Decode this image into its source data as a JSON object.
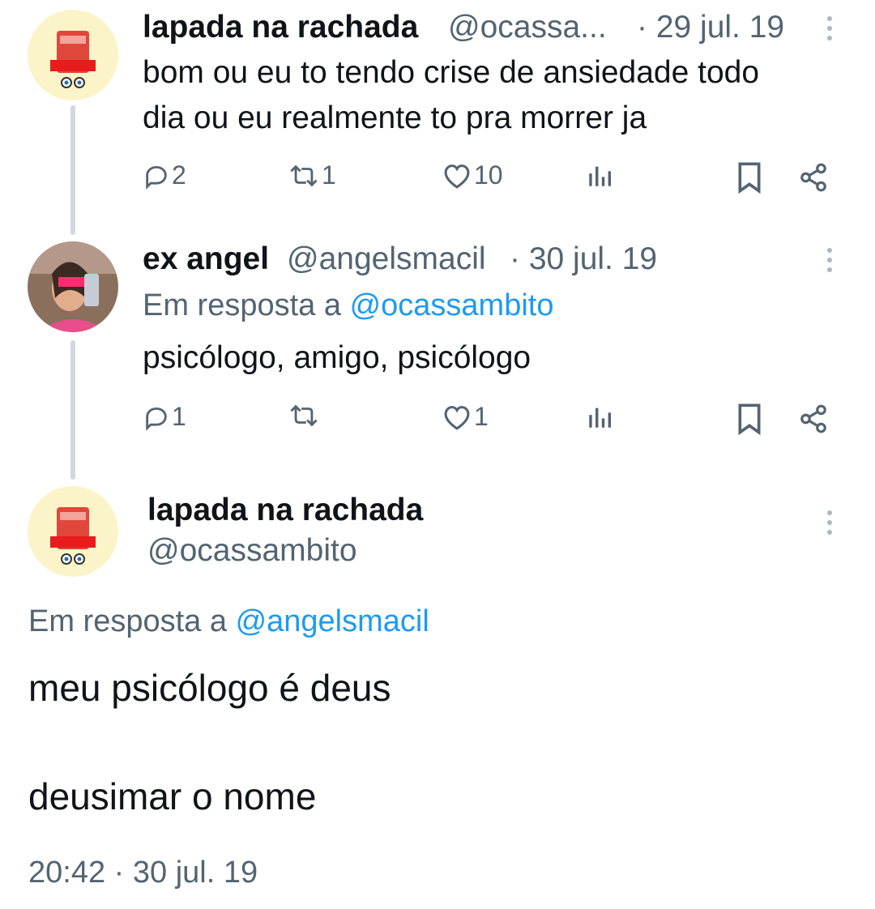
{
  "tweets": [
    {
      "name": "lapada na rachada",
      "handle": "@ocassa...",
      "date": "· 29 jul. 19",
      "text_line1": "bom ou eu to tendo crise de ansiedade todo",
      "text_line2": "dia ou eu realmente to pra morrer ja",
      "replies": "2",
      "retweets": "1",
      "likes": "10"
    },
    {
      "name": "ex angel",
      "handle": "@angelsmacil",
      "date": "· 30 jul. 19",
      "reply_prefix": "Em resposta a ",
      "reply_mention": "@ocassambito",
      "text": "psicólogo, amigo, psicólogo",
      "replies": "1",
      "retweets": "",
      "likes": "1"
    }
  ],
  "main_tweet": {
    "name": "lapada na rachada",
    "handle": "@ocassambito",
    "reply_prefix": "Em resposta a ",
    "reply_mention": "@angelsmacil",
    "text_line1": "meu psicólogo é deus",
    "text_line2": "deusimar o nome",
    "timestamp": "20:42 · 30 jul. 19"
  },
  "icons": {
    "reply": "reply-icon",
    "retweet": "retweet-icon",
    "like": "heart-icon",
    "views": "views-icon",
    "bookmark": "bookmark-icon",
    "share": "share-icon",
    "more": "more-vertical-icon"
  },
  "colors": {
    "text": "#0f1419",
    "secondary": "#536471",
    "link": "#1d9bf0",
    "thread_line": "#cfd9de"
  }
}
